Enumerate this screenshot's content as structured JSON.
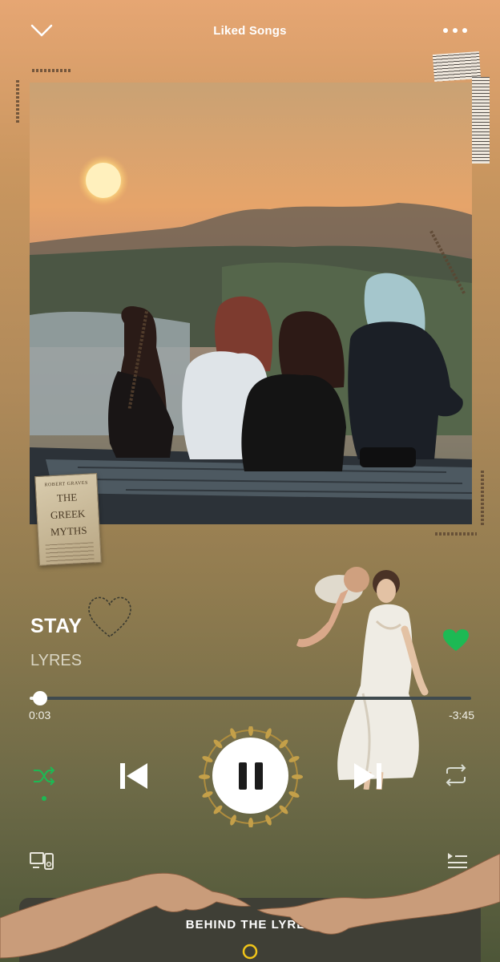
{
  "header": {
    "title": "Liked Songs",
    "collapse_icon": "chevron-down-icon",
    "menu_icon": "more-dots-icon"
  },
  "album": {
    "description_icon": "album-art"
  },
  "book": {
    "author": "ROBERT GRAVES",
    "title_line1": "THE",
    "title_line2": "GREEK",
    "title_line3": "MYTHS"
  },
  "track": {
    "title": "STAY",
    "artist": "LYRES",
    "liked": true
  },
  "playback": {
    "elapsed": "0:03",
    "remaining": "-3:45",
    "progress": 0.024,
    "state": "playing",
    "shuffle_on": true
  },
  "footer": {
    "lyrics_label": "BEHIND THE LYRES",
    "devices_icon": "connect-devices-icon",
    "queue_icon": "queue-icon"
  },
  "colors": {
    "accent": "#1db954",
    "background_top": "#e6a673",
    "background_bottom": "#4d5638",
    "lyrics_bar": "#3f3f36"
  }
}
